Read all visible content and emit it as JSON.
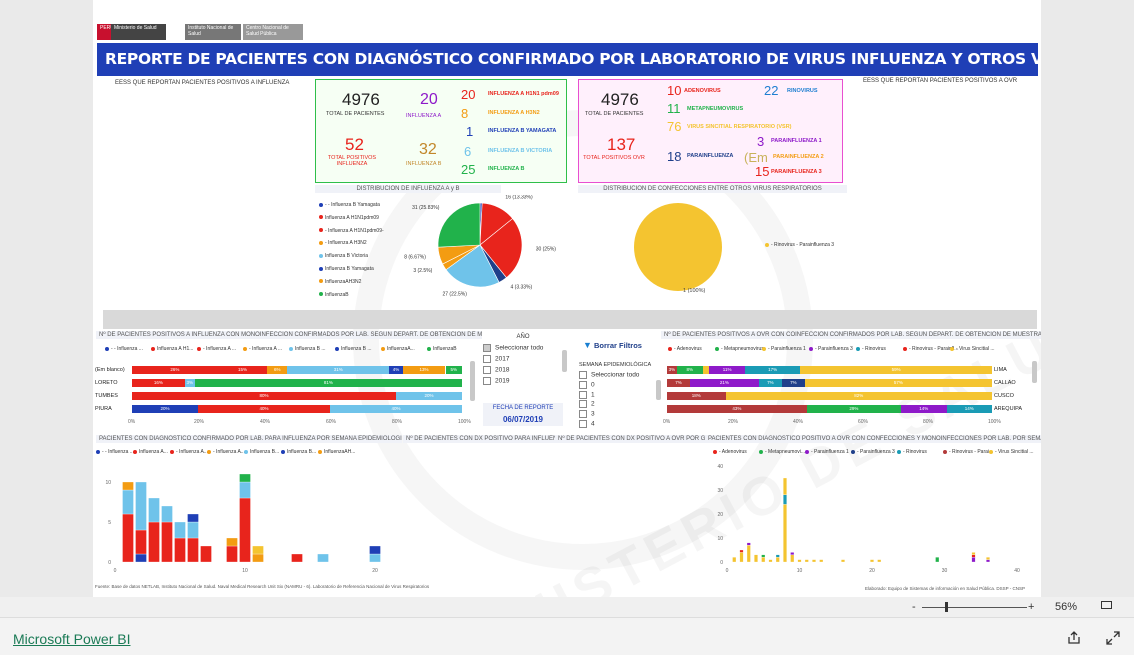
{
  "header": {
    "logo_peru": "PERÚ",
    "logo_ministerio": "Ministerio de Salud",
    "logo_ins": "Instituto Nacional de Salud",
    "logo_cnsp": "Centro Nacional de Salud Pública",
    "title": "REPORTE DE PACIENTES CON DIAGNÓSTICO CONFIRMADO POR LABORATORIO DE VIRUS INFLUENZA Y OTROS VIRUS RESPIRATORIOS"
  },
  "sections": {
    "eess_influenza": "EESS QUE REPORTAN PACIENTES POSITIVOS A INFLUENZA",
    "eess_ovr": "EESS QUE REPORTAN PACIENTES POSITIVOS A OVR",
    "pie_title": "DISTRIBUCIÓN DE INFLUENZA A y B",
    "ovr_pie_title": "DISTRIBUCIÓN DE CONFECCIONES ENTRE OTROS VIRUS RESPIRATORIOS"
  },
  "flu_kpis": {
    "total_value": "4976",
    "total_label": "TOTAL DE PACIENTES",
    "pos_value": "52",
    "pos_label": "TOTAL POSITIVOS INFLUENZA",
    "a_value": "20",
    "a_label": "INFLUENZA A",
    "b_value": "32",
    "b_label": "INFLUENZA B",
    "items": [
      {
        "value": "20",
        "label": "INFLUENZA A H1N1 pdm09",
        "color": "#e8241c"
      },
      {
        "value": "8",
        "label": "INFLUENZA A H3N2",
        "color": "#f39c12"
      },
      {
        "value": "1",
        "label": "INFLUENZA B YAMAGATA",
        "color": "#1f3fb6"
      },
      {
        "value": "6",
        "label": "INFLUENZA B VICTORIA",
        "color": "#6fc3ea"
      },
      {
        "value": "25",
        "label": "INFLUENZA B",
        "color": "#21b24b"
      }
    ]
  },
  "ovr_kpis": {
    "total_value": "4976",
    "total_label": "TOTAL DE PACIENTES",
    "pos_value": "137",
    "pos_label": "TOTAL POSITIVOS OVR",
    "items": [
      {
        "value": "10",
        "label": "ADENOVIRUS",
        "color": "#e8241c"
      },
      {
        "value": "11",
        "label": "METAPNEUMOVIRUS",
        "color": "#21b24b"
      },
      {
        "value": "76",
        "label": "VIRUS SINCITIAL RESPIRATORIO (VSR)",
        "color": "#f4c430"
      },
      {
        "value": "22",
        "label": "RINOVIRUS",
        "color": "#1f7fd1"
      },
      {
        "value": "3",
        "label": "PARAINFLUENZA 1",
        "color": "#8e1ac9"
      },
      {
        "value": "18",
        "label": "PARAINFLUENZA",
        "color": "#1f3f8a"
      },
      {
        "value": "15",
        "label": "PARAINFLUENZA 3",
        "color": "#e8241c"
      },
      {
        "value": "",
        "label": "PARAINFLUENZA 2",
        "color": "#f39c12"
      }
    ],
    "pi_em": "(Em"
  },
  "pie_legend": [
    {
      "label": "- - Influenza B Yamagata",
      "color": "#1f3fb6"
    },
    {
      "label": "Influenza A H1N1pdm09",
      "color": "#e8241c"
    },
    {
      "label": "- Influenza A H1N1pdm09-",
      "color": "#e8241c"
    },
    {
      "label": "- Influenza A H3N2",
      "color": "#f39c12"
    },
    {
      "label": "Influenza B Victoria",
      "color": "#6fc3ea"
    },
    {
      "label": "Influenza B Yamagata",
      "color": "#1f3fb6"
    },
    {
      "label": "InfluenzaAH3N2",
      "color": "#f39c12"
    },
    {
      "label": "InfluenzaB",
      "color": "#21b24b"
    }
  ],
  "ovr_pie_legend": {
    "label": "- Rinovirus - Parainfluenza 3",
    "color": "#f4c430",
    "slice_label": "1 (100%)"
  },
  "chart_data": [
    {
      "type": "pie",
      "title": "DISTRIBUCIÓN DE INFLUENZA A y B",
      "slices": [
        {
          "label": "1 (0.83%)",
          "value": 1,
          "color": "#1f3fb6"
        },
        {
          "label": "16 (13.33%)",
          "value": 16,
          "color": "#e8241c"
        },
        {
          "label": "30 (25%)",
          "value": 30,
          "color": "#e8241c"
        },
        {
          "label": "4 (3.33%)",
          "value": 4,
          "color": "#1f3f8a"
        },
        {
          "label": "27 (22.5%)",
          "value": 27,
          "color": "#6fc3ea"
        },
        {
          "label": "3 (2.5%)",
          "value": 3,
          "color": "#f39c12"
        },
        {
          "label": "8 (6.67%)",
          "value": 8,
          "color": "#f39c12"
        },
        {
          "label": "31 (25.83%)",
          "value": 31,
          "color": "#21b24b"
        }
      ]
    },
    {
      "type": "pie",
      "title": "DISTRIBUCIÓN DE CONFECCIONES ENTRE OTROS VIRUS RESPIRATORIOS",
      "slices": [
        {
          "label": "1 (100%)",
          "value": 1,
          "color": "#f4c430"
        }
      ]
    },
    {
      "type": "bar",
      "title": "Nº DE PACIENTES POSITIVOS A INFLUENZA CON MONOINFECCIÓN CONFIRMADOS POR LAB. SEGÚN DEPART. DE OBTENCIÓN DE MUESTRAS",
      "legend": [
        "- - Influenza ...",
        "Influenza A H1...",
        "- Influenza A ...",
        "- Influenza A ...",
        "Influenza B ...",
        "Influenza B ...",
        "InfluenzaA...",
        "InfluenzaB"
      ],
      "legend_colors": [
        "#1f3fb6",
        "#e8241c",
        "#e8241c",
        "#f39c12",
        "#6fc3ea",
        "#1f3fb6",
        "#f39c12",
        "#21b24b"
      ],
      "categories": [
        "(Em blanco)",
        "LORETO",
        "TUMBES",
        "PIURA"
      ],
      "rows": [
        [
          {
            "v": 26,
            "c": "#e8241c",
            "t": "26%"
          },
          {
            "v": 15,
            "c": "#e8241c",
            "t": "15%"
          },
          {
            "v": 6,
            "c": "#f39c12",
            "t": "6%"
          },
          {
            "v": 31,
            "c": "#6fc3ea",
            "t": "31%"
          },
          {
            "v": 4,
            "c": "#1f3fb6",
            "t": "4%"
          },
          {
            "v": 13,
            "c": "#f39c12",
            "t": "13%"
          },
          {
            "v": 5,
            "c": "#21b24b",
            "t": "5%"
          }
        ],
        [
          {
            "v": 16,
            "c": "#e8241c",
            "t": "16%"
          },
          {
            "v": 3,
            "c": "#6fc3ea",
            "t": "3%"
          },
          {
            "v": 81,
            "c": "#21b24b",
            "t": "81%"
          }
        ],
        [
          {
            "v": 80,
            "c": "#e8241c",
            "t": "80%"
          },
          {
            "v": 20,
            "c": "#6fc3ea",
            "t": "20%"
          }
        ],
        [
          {
            "v": 20,
            "c": "#1f3fb6",
            "t": "20%"
          },
          {
            "v": 40,
            "c": "#e8241c",
            "t": "40%"
          },
          {
            "v": 40,
            "c": "#6fc3ea",
            "t": "40%"
          }
        ]
      ],
      "ticks": [
        "0%",
        "20%",
        "40%",
        "60%",
        "80%",
        "100%"
      ]
    },
    {
      "type": "bar",
      "title": "Nº DE PACIENTES POSITIVOS A OVR CON COINFECCIÓN CONFIRMADOS POR LAB. SEGÚN DEPART. DE OBTENCIÓN DE MUESTRA",
      "legend": [
        "- Adenovirus",
        "- Metapneumovirus",
        "- Parainfluenza 1",
        "- Parainfluenza 3",
        "- Rinovirus",
        "- Rinovirus - Parainfl...",
        "- Virus Sincitial ..."
      ],
      "legend_colors": [
        "#e8241c",
        "#21b24b",
        "#f4c430",
        "#8e1ac9",
        "#1a9bb5",
        "#e8241c",
        "#f4c430"
      ],
      "categories": [
        "LIMA",
        "CALLAO",
        "CUSCO",
        "AREQUIPA"
      ],
      "rows": [
        [
          {
            "v": 3,
            "c": "#b33a3a",
            "t": "3%"
          },
          {
            "v": 8,
            "c": "#21b24b",
            "t": "8%"
          },
          {
            "v": 2,
            "c": "#f4c430",
            "t": ""
          },
          {
            "v": 11,
            "c": "#8e1ac9",
            "t": "11%"
          },
          {
            "v": 17,
            "c": "#1a9bb5",
            "t": "17%"
          },
          {
            "v": 59,
            "c": "#f4c430",
            "t": "59%"
          }
        ],
        [
          {
            "v": 7,
            "c": "#b33a3a",
            "t": "7%"
          },
          {
            "v": 21,
            "c": "#8e1ac9",
            "t": "21%"
          },
          {
            "v": 7,
            "c": "#1a9bb5",
            "t": "7%"
          },
          {
            "v": 7,
            "c": "#1f3f8a",
            "t": "7%"
          },
          {
            "v": 57,
            "c": "#f4c430",
            "t": "57%"
          }
        ],
        [
          {
            "v": 18,
            "c": "#b33a3a",
            "t": "18%"
          },
          {
            "v": 82,
            "c": "#f4c430",
            "t": "82%"
          }
        ],
        [
          {
            "v": 43,
            "c": "#b33a3a",
            "t": "43%"
          },
          {
            "v": 29,
            "c": "#21b24b",
            "t": "29%"
          },
          {
            "v": 14,
            "c": "#8e1ac9",
            "t": "14%"
          },
          {
            "v": 14,
            "c": "#1a9bb5",
            "t": "14%"
          }
        ]
      ],
      "ticks": [
        "0%",
        "20%",
        "40%",
        "60%",
        "80%",
        "100%"
      ]
    },
    {
      "type": "bar",
      "title": "PACIENTES CON DIAGNÓSTICO CONFIRMADO POR LAB. PARA INFLUENZA POR SEMANA EPIDEMIOLÓGICA",
      "legend": [
        "- - Influenza ...",
        "Influenza A...",
        "- Influenza A...",
        "- Influenza A...",
        "Influenza B...",
        "Influenza B...",
        "InfluenzaAH..."
      ],
      "legend_colors": [
        "#1f3fb6",
        "#e8241c",
        "#e8241c",
        "#f39c12",
        "#6fc3ea",
        "#1f3fb6",
        "#f39c12"
      ],
      "xticks": [
        "0",
        "10",
        "20"
      ],
      "yticks": [
        "0",
        "5",
        "10"
      ],
      "ylim": [
        0,
        12
      ],
      "x": [
        1,
        2,
        3,
        4,
        5,
        6,
        7,
        8,
        9,
        10,
        11,
        14,
        16,
        20
      ],
      "stacks": [
        [
          {
            "v": 6,
            "c": "#e8241c"
          },
          {
            "v": 3,
            "c": "#6fc3ea"
          },
          {
            "v": 1,
            "c": "#f39c12"
          }
        ],
        [
          {
            "v": 1,
            "c": "#1f3fb6"
          },
          {
            "v": 3,
            "c": "#e8241c"
          },
          {
            "v": 6,
            "c": "#6fc3ea"
          }
        ],
        [
          {
            "v": 5,
            "c": "#e8241c"
          },
          {
            "v": 3,
            "c": "#6fc3ea"
          }
        ],
        [
          {
            "v": 5,
            "c": "#e8241c"
          },
          {
            "v": 2,
            "c": "#6fc3ea"
          }
        ],
        [
          {
            "v": 3,
            "c": "#e8241c"
          },
          {
            "v": 2,
            "c": "#6fc3ea"
          }
        ],
        [
          {
            "v": 3,
            "c": "#e8241c"
          },
          {
            "v": 2,
            "c": "#6fc3ea"
          },
          {
            "v": 1,
            "c": "#1f3fb6"
          }
        ],
        [
          {
            "v": 2,
            "c": "#e8241c"
          }
        ],
        [],
        [
          {
            "v": 2,
            "c": "#e8241c"
          },
          {
            "v": 1,
            "c": "#f39c12"
          }
        ],
        [
          {
            "v": 8,
            "c": "#e8241c"
          },
          {
            "v": 2,
            "c": "#6fc3ea"
          },
          {
            "v": 1,
            "c": "#21b24b"
          }
        ],
        [
          {
            "v": 1,
            "c": "#f39c12"
          },
          {
            "v": 1,
            "c": "#f4c430"
          }
        ],
        [
          {
            "v": 1,
            "c": "#e8241c"
          }
        ],
        [
          {
            "v": 1,
            "c": "#6fc3ea"
          }
        ],
        [
          {
            "v": 1,
            "c": "#6fc3ea"
          },
          {
            "v": 1,
            "c": "#1f3fb6"
          }
        ]
      ]
    },
    {
      "type": "bar",
      "title": "PACIENTES CON DIAGNÓSTICO POSITIVO A OVR CON CONFECCIONES Y MONOINFECCIONES POR LAB. POR SEMANA EPID...",
      "legend": [
        "- Adenovirus",
        "- Metapneumovi...",
        "- Parainfluenza 1",
        "- Parainfluenza 3",
        "- Rinovirus",
        "- Rinovirus - Parai...",
        "- Virus Sincitial ..."
      ],
      "legend_colors": [
        "#e8241c",
        "#21b24b",
        "#8e1ac9",
        "#1f3f8a",
        "#1a9bb5",
        "#b33a3a",
        "#f4c430"
      ],
      "xticks": [
        "0",
        "10",
        "20",
        "30",
        "40"
      ],
      "yticks": [
        "0",
        "10",
        "20",
        "30",
        "40"
      ],
      "ylim": [
        0,
        40
      ],
      "x": [
        1,
        2,
        3,
        4,
        5,
        6,
        7,
        8,
        9,
        10,
        11,
        12,
        13,
        16,
        20,
        21,
        29,
        34,
        36
      ],
      "stacks": [
        [
          {
            "v": 2,
            "c": "#f4c430"
          }
        ],
        [
          {
            "v": 4,
            "c": "#f4c430"
          },
          {
            "v": 1,
            "c": "#e8241c"
          }
        ],
        [
          {
            "v": 7,
            "c": "#f4c430"
          },
          {
            "v": 1,
            "c": "#8e1ac9"
          }
        ],
        [
          {
            "v": 3,
            "c": "#f4c430"
          }
        ],
        [
          {
            "v": 2,
            "c": "#f4c430"
          },
          {
            "v": 1,
            "c": "#21b24b"
          }
        ],
        [
          {
            "v": 1,
            "c": "#f4c430"
          }
        ],
        [
          {
            "v": 2,
            "c": "#f4c430"
          },
          {
            "v": 1,
            "c": "#1a9bb5"
          }
        ],
        [
          {
            "v": 24,
            "c": "#f4c430"
          },
          {
            "v": 4,
            "c": "#1a9bb5"
          },
          {
            "v": 7,
            "c": "#f4c430"
          }
        ],
        [
          {
            "v": 3,
            "c": "#f4c430"
          },
          {
            "v": 1,
            "c": "#8e1ac9"
          }
        ],
        [
          {
            "v": 1,
            "c": "#f4c430"
          }
        ],
        [
          {
            "v": 1,
            "c": "#f4c430"
          }
        ],
        [
          {
            "v": 1,
            "c": "#f4c430"
          }
        ],
        [
          {
            "v": 1,
            "c": "#f4c430"
          }
        ],
        [
          {
            "v": 1,
            "c": "#f4c430"
          }
        ],
        [
          {
            "v": 1,
            "c": "#f4c430"
          }
        ],
        [
          {
            "v": 1,
            "c": "#f4c430"
          }
        ],
        [
          {
            "v": 2,
            "c": "#21b24b"
          }
        ],
        [
          {
            "v": 2,
            "c": "#8e1ac9"
          },
          {
            "v": 1,
            "c": "#e8241c"
          },
          {
            "v": 1,
            "c": "#f4c430"
          }
        ],
        [
          {
            "v": 1,
            "c": "#8e1ac9"
          },
          {
            "v": 1,
            "c": "#f4c430"
          }
        ]
      ]
    }
  ],
  "slicers": {
    "year_title": "AÑO",
    "years": [
      "Seleccionar todo",
      "2017",
      "2018",
      "2019"
    ],
    "report_date_title": "FECHA DE REPORTE",
    "report_date": "06/07/2019",
    "clear_filters": "Borrar Filtros",
    "week_title": "SEMANA EPIDEMIOLÓGICA",
    "weeks": [
      "Seleccionar todo",
      "0",
      "1",
      "2",
      "3",
      "4"
    ]
  },
  "mid_titles": {
    "ovr_dx_1": "Nº DE PACIENTES CON DX POSITIVO PARA INFLUEN...",
    "ovr_dx_2": "Nº DE PACIENTES CON DX POSITIVO A OVR POR GRU..."
  },
  "footer": {
    "source": "Fuente: Base de datos NETLAB, Instituto Nacional de Salud. Naval Medical Research Unit Six (NAMRU - 6). Laboratorio de Referencia Nacional de Virus Respiratorios",
    "elaborated": "Elaborado: Equipo de Sistemas de información en Salud Pública. DSSP - CNSP",
    "zoom": "56%",
    "brand": "Microsoft Power BI",
    "minus": "-",
    "plus": "+"
  }
}
